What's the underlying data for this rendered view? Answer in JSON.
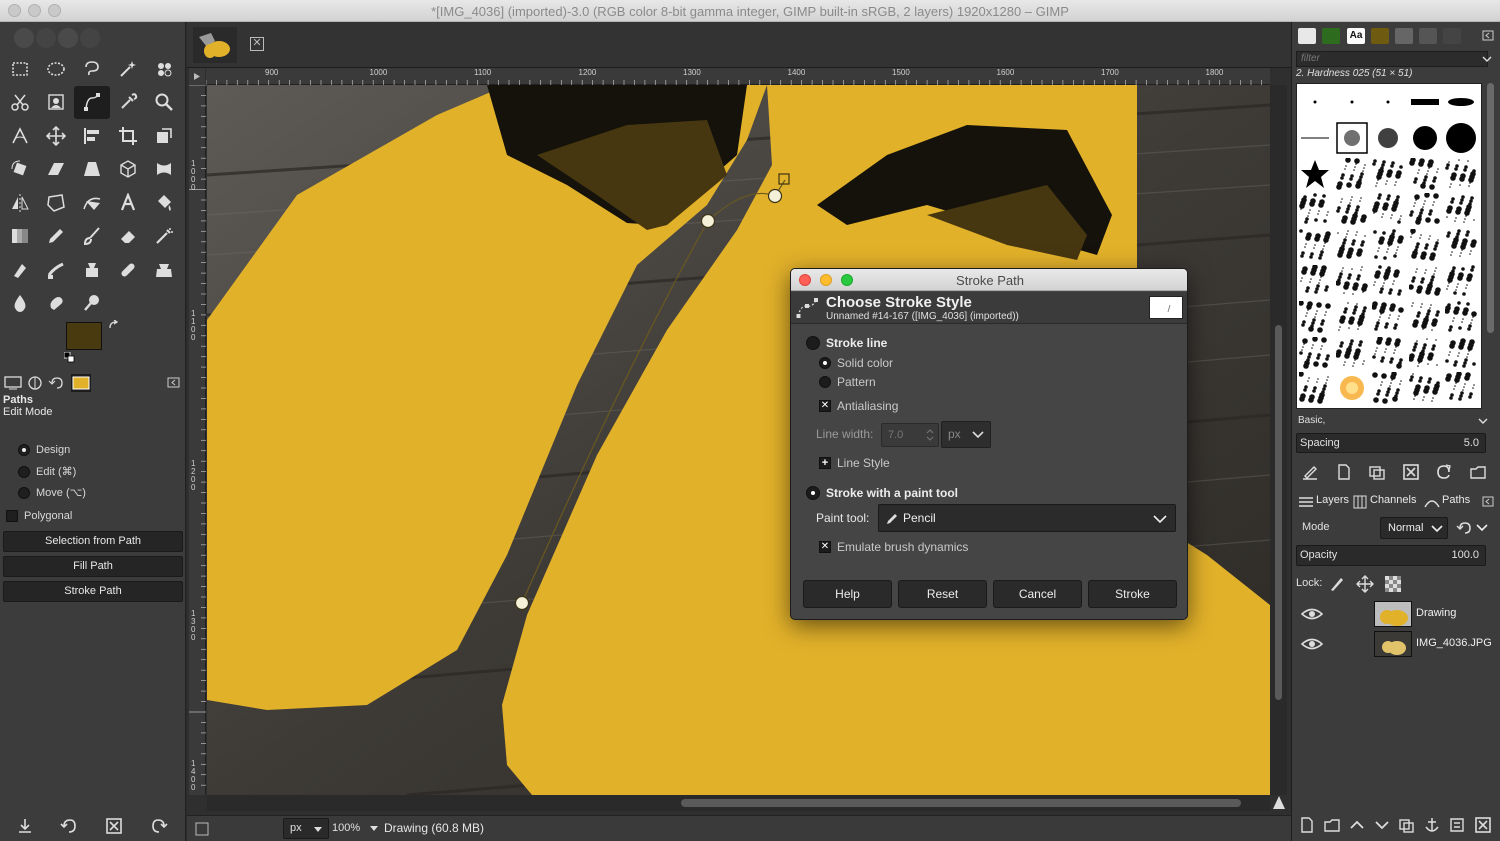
{
  "window": {
    "title": "*[IMG_4036] (imported)-3.0 (RGB color 8-bit gamma integer, GIMP built-in sRGB, 2 layers) 1920x1280 – GIMP"
  },
  "toolbox": {
    "tools": [
      "rect-select",
      "ellipse-select",
      "free-select",
      "fuzzy-select",
      "select-by-color",
      "scissors-select",
      "foreground-select",
      "paths",
      "color-picker",
      "zoom",
      "measure",
      "move",
      "align",
      "crop",
      "unified-transform",
      "rotate",
      "shear",
      "perspective",
      "3d-transform",
      "warp-transform",
      "flip",
      "cage-transform",
      "handle-transform",
      "text",
      "bucket-fill",
      "blend",
      "pencil",
      "paintbrush",
      "eraser",
      "airbrush",
      "ink",
      "mypaint-brush",
      "clone",
      "heal",
      "perspective-clone",
      "blur-sharpen",
      "smudge",
      "dodge-burn"
    ],
    "active_tool": "paths",
    "foreground_color": "#4a3a0f",
    "background_color": "#ffffff",
    "options": {
      "title": "Paths",
      "subtitle": "Edit Mode",
      "modes": [
        "Design",
        "Edit (⌘)",
        "Move (⌥)"
      ],
      "selected_mode": "Design",
      "polygonal_label": "Polygonal",
      "buttons": [
        "Selection from Path",
        "Fill Path",
        "Stroke Path"
      ]
    }
  },
  "image_window": {
    "ruler_labels": [
      "900",
      "1000",
      "1100",
      "1200",
      "1300",
      "1400",
      "1500",
      "1600",
      "1700",
      "1800"
    ],
    "vertical_ruler_labels": [
      "1000",
      "1100",
      "1200",
      "1300",
      "1400"
    ],
    "status": {
      "unit": "px",
      "zoom": "100%",
      "text": "Drawing (60.8 MB)"
    }
  },
  "dialog": {
    "window_title": "Stroke Path",
    "header_title": "Choose Stroke Style",
    "header_subtitle": "Unnamed #14-167 ([IMG_4036] (imported))",
    "stroke_line_label": "Stroke line",
    "solid_color_label": "Solid color",
    "pattern_label": "Pattern",
    "antialiasing_label": "Antialiasing",
    "line_width_label": "Line width:",
    "line_width_value": "7.0",
    "line_width_unit": "px",
    "line_style_label": "Line Style",
    "paint_tool_option_label": "Stroke with a paint tool",
    "paint_tool_label": "Paint tool:",
    "paint_tool_value": "Pencil",
    "emulate_label": "Emulate brush dynamics",
    "buttons": {
      "help": "Help",
      "reset": "Reset",
      "cancel": "Cancel",
      "stroke": "Stroke"
    }
  },
  "dock": {
    "filter_placeholder": "filter",
    "brush_name": "2. Hardness 025 (51 × 51)",
    "brush_set": "Basic,",
    "spacing_label": "Spacing",
    "spacing_value": "5.0",
    "tabs": [
      "Layers",
      "Channels",
      "Paths"
    ],
    "mode_label": "Mode",
    "mode_value": "Normal",
    "opacity_label": "Opacity",
    "opacity_value": "100.0",
    "lock_label": "Lock:",
    "layers": [
      {
        "name": "Drawing"
      },
      {
        "name": "IMG_4036.JPG"
      }
    ]
  }
}
